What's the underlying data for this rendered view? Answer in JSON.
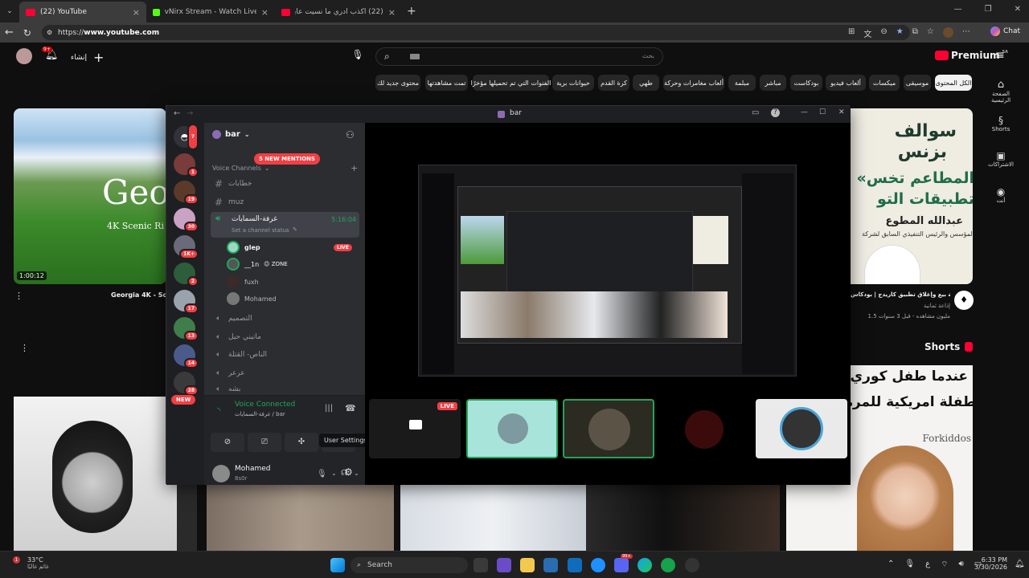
{
  "browser": {
    "tabs": [
      {
        "label": "(22) YouTube",
        "active": true
      },
      {
        "label": "vNirx Stream - Watch Live on Kick",
        "active": false
      },
      {
        "label": "(22) اكذب ادري ما نسيت عايض - ...",
        "active": false
      }
    ],
    "url_prefix": "https://",
    "url_host": "www.youtube.com"
  },
  "youtube": {
    "logo_text": "Premium",
    "region": "SA",
    "search_placeholder": "بحث",
    "create_label": "إنشاء",
    "notif_count": "9+",
    "chips": [
      "الكل المحتوى",
      "موسيقى",
      "ميكسات",
      "ألعاب فيديو",
      "بودكاست",
      "مباشر",
      "مبلمة",
      "ألعاب مغامرات وحركة",
      "طهي",
      "كرة القدم",
      "حيوانات برية",
      "الفنوات التي تم تحميلها مؤخرًا",
      "تمت مشاهدتها",
      "محتوى جديد لك"
    ],
    "right_nav": [
      "الصفحة الرئيسية",
      "Shorts",
      "الاشتراكات",
      "أنت"
    ],
    "left_video": {
      "title_overlay": "Geo",
      "subtitle": "4K Scenic Ri",
      "duration": "1:00:12",
      "title": "Georgia 4K - Sc"
    },
    "right_video": {
      "art_line1": "سوالف",
      "art_line2": "بزنس",
      "art_line3": "«المطاعم تخس",
      "art_line4": "تطبيقات التو",
      "person": "عبدالله المطوع",
      "person_role": "المؤسس والرئيس التنفيذي السابق لشركة",
      "title": "قصة بيع وإغلاق تطبيق كاريدج | بودكاس",
      "channel": "إذاعة ثمانية",
      "meta": "1.5 مليون مشاهده - قبل 3 سنوات"
    },
    "shorts_label": "Shorts",
    "short_caption_1": "عندما طفل كوري",
    "short_caption_2": "طفلة امريكية للمرة الأ",
    "short_brand": "Forkiddos"
  },
  "discord": {
    "window_title": "bar",
    "server_name": "bar",
    "mentions_banner": "5 NEW MENTIONS",
    "new_badge": "NEW",
    "category": "Voice Channels",
    "channels": [
      {
        "name": "خطابات",
        "type": "text"
      },
      {
        "name": "muz",
        "type": "text"
      }
    ],
    "active_voice": {
      "name": "غرفة-السمايات",
      "timer": "5:16:04",
      "status": "Set a channel status"
    },
    "voice_users": [
      {
        "name": "glep",
        "live": "LIVE"
      },
      {
        "name": "__1n",
        "extra": "😉 ZONE"
      },
      {
        "name": "fuxh"
      },
      {
        "name": "Mohamed"
      }
    ],
    "other_voice": [
      "التصميم",
      "ماتيني حيل",
      "الناص- القتلة",
      "عرعر",
      "بشه"
    ],
    "server_badges": [
      "7",
      "1",
      "19",
      "30",
      "1K+",
      "2",
      "17",
      "13",
      "14",
      "28"
    ],
    "voice_connected": "Voice Connected",
    "voice_path": "غرفة-السمايات / bar",
    "tooltip": "User Settings",
    "me_name": "Mohamed",
    "me_tag": "8s0r",
    "live_tag": "LIVE"
  },
  "taskbar": {
    "weather_temp": "33°C",
    "weather_desc": "غائم غالبًا",
    "search": "Search",
    "time": "6:33 PM",
    "date": "3/30/2026",
    "lang": "ع",
    "badge_count": "99+"
  }
}
